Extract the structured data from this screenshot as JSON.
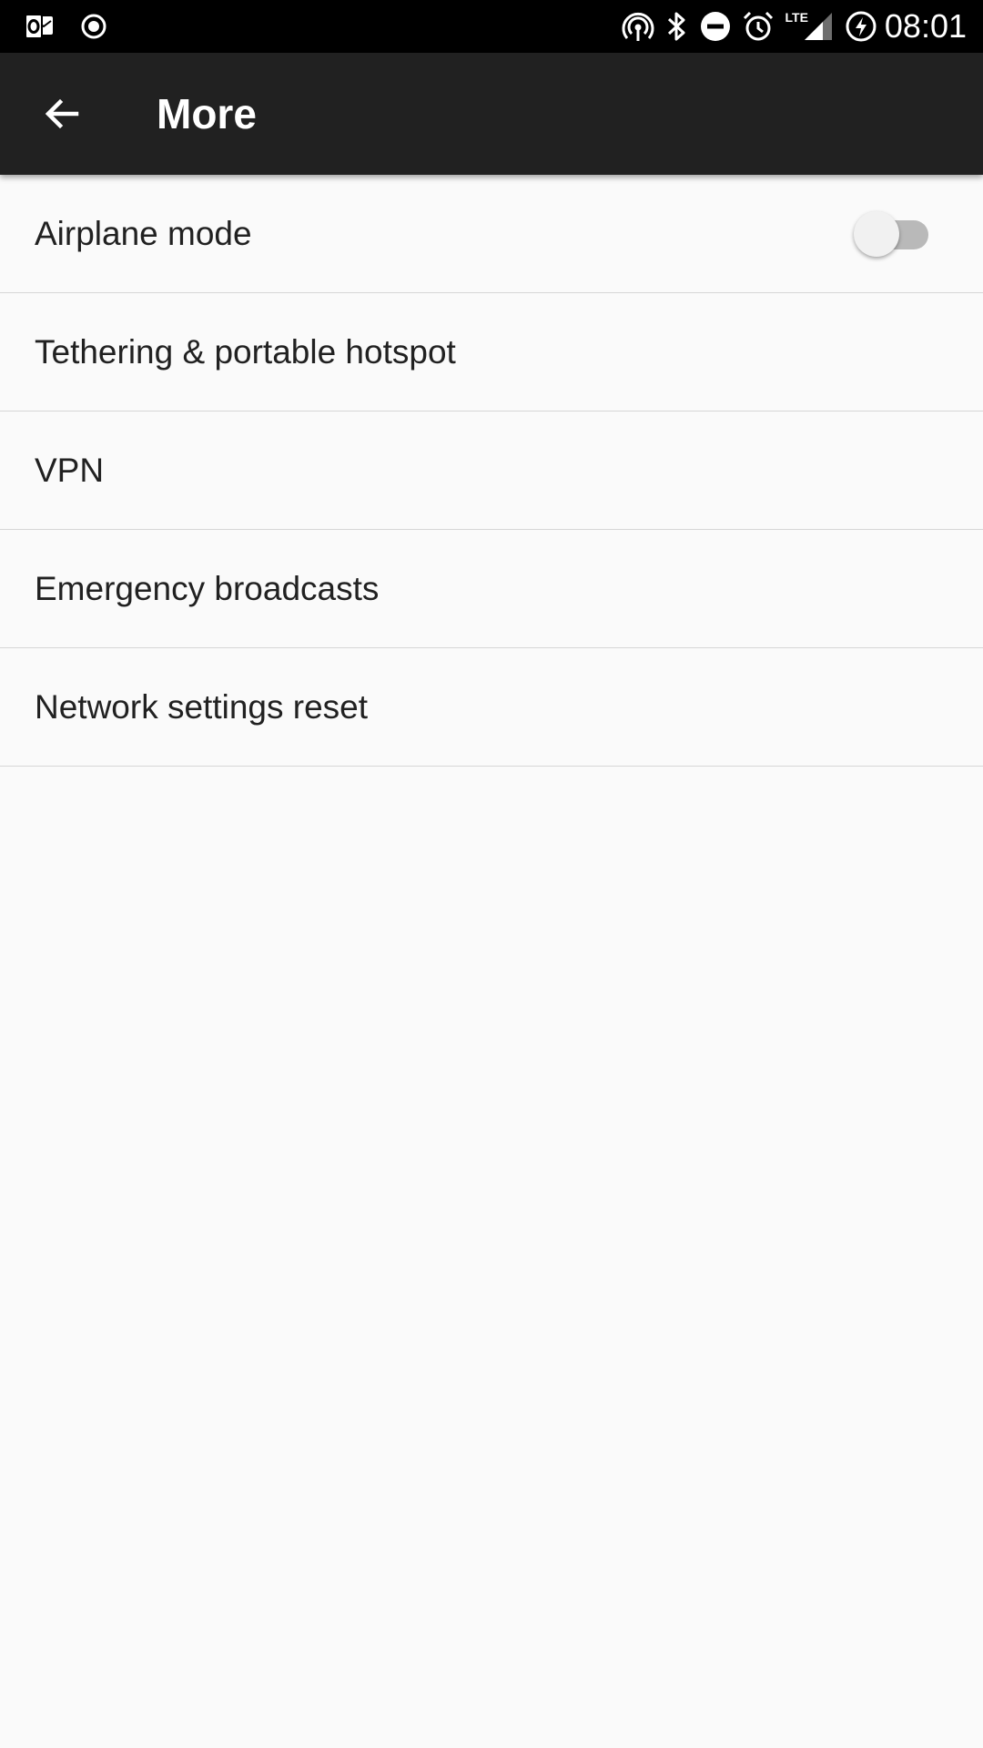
{
  "status_bar": {
    "time": "08:01",
    "network_type": "LTE",
    "left_icons": [
      "outlook-icon",
      "screen-record-icon"
    ],
    "right_icons": [
      "hotspot-icon",
      "bluetooth-icon",
      "do-not-disturb-icon",
      "alarm-icon",
      "cell-signal-icon",
      "battery-charging-icon"
    ]
  },
  "app_bar": {
    "title": "More",
    "back_icon": "arrow-back-icon"
  },
  "settings": {
    "items": [
      {
        "label": "Airplane mode",
        "toggle": {
          "on": false
        }
      },
      {
        "label": "Tethering & portable hotspot"
      },
      {
        "label": "VPN"
      },
      {
        "label": "Emergency broadcasts"
      },
      {
        "label": "Network settings reset"
      }
    ]
  },
  "colors": {
    "status_bar": "#000000",
    "app_bar": "#212121",
    "background": "#fafafa",
    "text_primary": "#212121",
    "divider": "#d6d6d6",
    "toggle_track_off": "#b9b9b9",
    "toggle_thumb_off": "#f1f1f1"
  }
}
